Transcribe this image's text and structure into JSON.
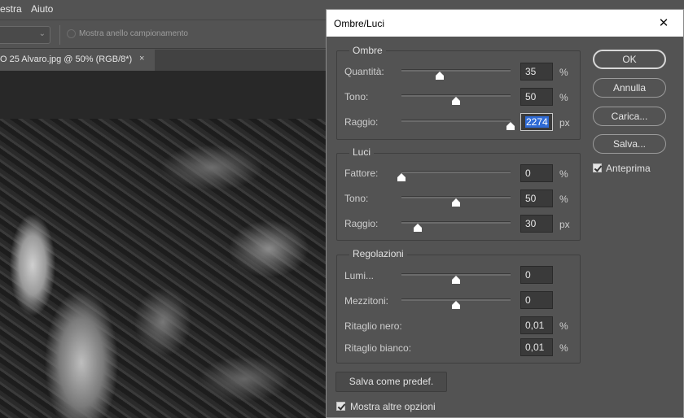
{
  "menubar": {
    "items": [
      "estra",
      "Aiuto"
    ]
  },
  "optionsbar": {
    "sample_ring_label": "Mostra anello campionamento"
  },
  "document_tab": {
    "label": "O 25 Alvaro.jpg @ 50% (RGB/8*)",
    "close_glyph": "×"
  },
  "dialog": {
    "title": "Ombre/Luci",
    "close_glyph": "✕",
    "shadows": {
      "title": "Ombre",
      "rows": [
        {
          "label": "Quantità:",
          "value": "35",
          "unit": "%",
          "level": 0.35
        },
        {
          "label": "Tono:",
          "value": "50",
          "unit": "%",
          "level": 0.5
        },
        {
          "label": "Raggio:",
          "value": "2274",
          "unit": "px",
          "level": 1.0
        }
      ]
    },
    "highlights": {
      "title": "Luci",
      "rows": [
        {
          "label": "Fattore:",
          "value": "0",
          "unit": "%",
          "level": 0.0
        },
        {
          "label": "Tono:",
          "value": "50",
          "unit": "%",
          "level": 0.5
        },
        {
          "label": "Raggio:",
          "value": "30",
          "unit": "px",
          "level": 0.15
        }
      ]
    },
    "adjustments": {
      "title": "Regolazioni",
      "rows": [
        {
          "label": "Lumi...",
          "value": "0",
          "unit": "",
          "level": 0.5
        },
        {
          "label": "Mezzitoni:",
          "value": "0",
          "unit": "",
          "level": 0.5
        },
        {
          "label": "Ritaglio nero:",
          "value": "0,01",
          "unit": "%"
        },
        {
          "label": "Ritaglio bianco:",
          "value": "0,01",
          "unit": "%"
        }
      ]
    },
    "buttons": {
      "ok": "OK",
      "cancel": "Annulla",
      "load": "Carica...",
      "save": "Salva...",
      "save_default": "Salva come predef."
    },
    "preview": {
      "label": "Anteprima",
      "checked": true
    },
    "more_options": {
      "label": "Mostra altre opzioni",
      "checked": true
    }
  }
}
